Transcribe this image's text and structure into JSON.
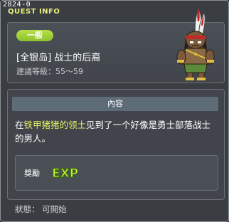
{
  "window": {
    "id": "2824-0",
    "title": "QUEST INFO"
  },
  "quest": {
    "category": "一般",
    "title": "[全银岛]  战士的后裔",
    "level_line": "建議等級：55～59"
  },
  "content": {
    "header": "內容",
    "desc_prefix": "在",
    "desc_highlight": "铁甲猪猪的领土",
    "desc_suffix": "见到了一个好像是勇士部落战士的男人。"
  },
  "reward": {
    "label": "獎勵",
    "exp_text": "EXP"
  },
  "status": {
    "text": "狀態：  可開始"
  },
  "colors": {
    "accent_green": "#9ccd36",
    "highlight_yellow": "#e6f06a",
    "header_bar": "#5e6c78"
  },
  "icons": {
    "portrait": "tribal-warrior-npc",
    "reward": "exp-icon"
  }
}
